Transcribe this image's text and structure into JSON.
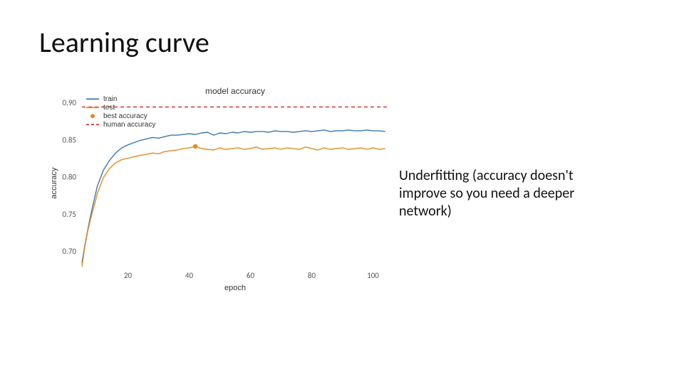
{
  "title": "Learning curve",
  "annotation": "Underfitting (accuracy doesn't improve so you need a deeper network)",
  "chart_data": {
    "type": "line",
    "title": "model accuracy",
    "xlabel": "epoch",
    "ylabel": "accuracy",
    "xlim": [
      5,
      105
    ],
    "ylim": [
      0.68,
      0.905
    ],
    "xticks": [
      20,
      40,
      60,
      80,
      100
    ],
    "yticks": [
      0.7,
      0.75,
      0.8,
      0.85,
      0.9
    ],
    "best_accuracy_point": {
      "x": 42,
      "y": 0.842
    },
    "human_accuracy": 0.895,
    "legend": {
      "train": {
        "label": "train",
        "color": "#3b78b5",
        "type": "line"
      },
      "test": {
        "label": "test",
        "color": "#e38a23",
        "type": "line"
      },
      "best": {
        "label": "best accuracy",
        "color": "#e38a23",
        "type": "marker"
      },
      "human": {
        "label": "human accuracy",
        "color": "#d62728",
        "type": "dashed"
      }
    },
    "series": [
      {
        "name": "train",
        "color": "#3b78b5",
        "x": [
          5,
          6,
          7,
          8,
          9,
          10,
          12,
          14,
          16,
          18,
          20,
          22,
          24,
          26,
          28,
          30,
          32,
          34,
          36,
          38,
          40,
          42,
          44,
          46,
          48,
          50,
          52,
          54,
          56,
          58,
          60,
          62,
          64,
          66,
          68,
          70,
          72,
          74,
          76,
          78,
          80,
          82,
          84,
          86,
          88,
          90,
          92,
          94,
          96,
          98,
          100,
          102,
          104
        ],
        "y": [
          0.685,
          0.71,
          0.732,
          0.752,
          0.77,
          0.788,
          0.81,
          0.823,
          0.833,
          0.84,
          0.844,
          0.847,
          0.85,
          0.852,
          0.854,
          0.853,
          0.855,
          0.857,
          0.857,
          0.858,
          0.859,
          0.858,
          0.86,
          0.861,
          0.857,
          0.86,
          0.859,
          0.861,
          0.86,
          0.862,
          0.861,
          0.862,
          0.862,
          0.861,
          0.863,
          0.862,
          0.862,
          0.861,
          0.862,
          0.863,
          0.862,
          0.863,
          0.864,
          0.862,
          0.863,
          0.863,
          0.864,
          0.863,
          0.863,
          0.864,
          0.863,
          0.863,
          0.862
        ]
      },
      {
        "name": "test",
        "color": "#e38a23",
        "x": [
          5,
          6,
          7,
          8,
          9,
          10,
          12,
          14,
          16,
          18,
          20,
          22,
          24,
          26,
          28,
          30,
          32,
          34,
          36,
          38,
          40,
          42,
          44,
          46,
          48,
          50,
          52,
          54,
          56,
          58,
          60,
          62,
          64,
          66,
          68,
          70,
          72,
          74,
          76,
          78,
          80,
          82,
          84,
          86,
          88,
          90,
          92,
          94,
          96,
          98,
          100,
          102,
          104
        ],
        "y": [
          0.68,
          0.708,
          0.73,
          0.747,
          0.762,
          0.778,
          0.8,
          0.812,
          0.82,
          0.824,
          0.826,
          0.828,
          0.83,
          0.831,
          0.833,
          0.832,
          0.835,
          0.836,
          0.837,
          0.839,
          0.84,
          0.842,
          0.839,
          0.838,
          0.837,
          0.84,
          0.838,
          0.839,
          0.84,
          0.838,
          0.839,
          0.841,
          0.838,
          0.839,
          0.84,
          0.838,
          0.84,
          0.839,
          0.838,
          0.841,
          0.839,
          0.837,
          0.84,
          0.838,
          0.839,
          0.84,
          0.838,
          0.839,
          0.84,
          0.838,
          0.84,
          0.838,
          0.839
        ]
      }
    ]
  }
}
